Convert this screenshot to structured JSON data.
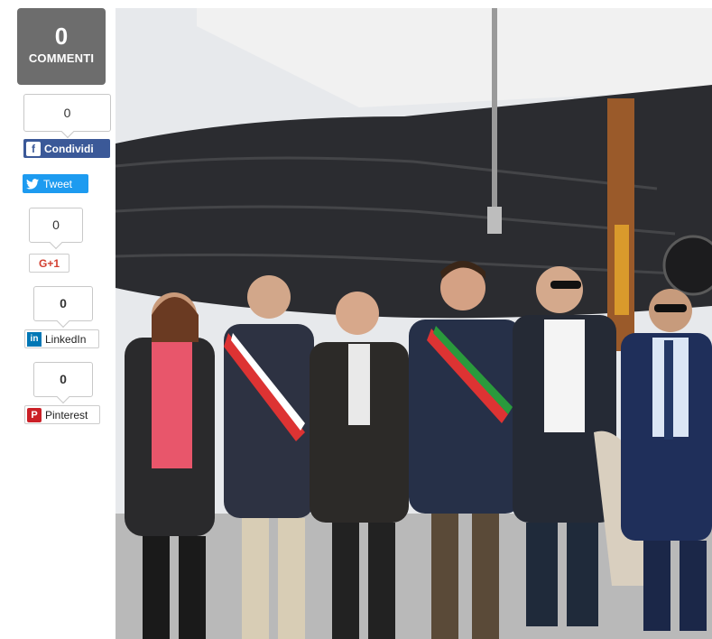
{
  "comments": {
    "count": "0",
    "label": "COMMENTI"
  },
  "facebook": {
    "count": "0",
    "label": "Condividi"
  },
  "twitter": {
    "label": "Tweet"
  },
  "googleplus": {
    "count": "0",
    "label": "G+1"
  },
  "linkedin": {
    "count": "0",
    "label": "LinkedIn"
  },
  "pinterest": {
    "count": "0",
    "label": "Pinterest"
  },
  "colors": {
    "comments_bg": "#6d6d6d",
    "facebook": "#3b5998",
    "twitter": "#1d9bf0",
    "googleplus": "#d23f31",
    "linkedin": "#0077b5",
    "pinterest": "#cb2027"
  }
}
